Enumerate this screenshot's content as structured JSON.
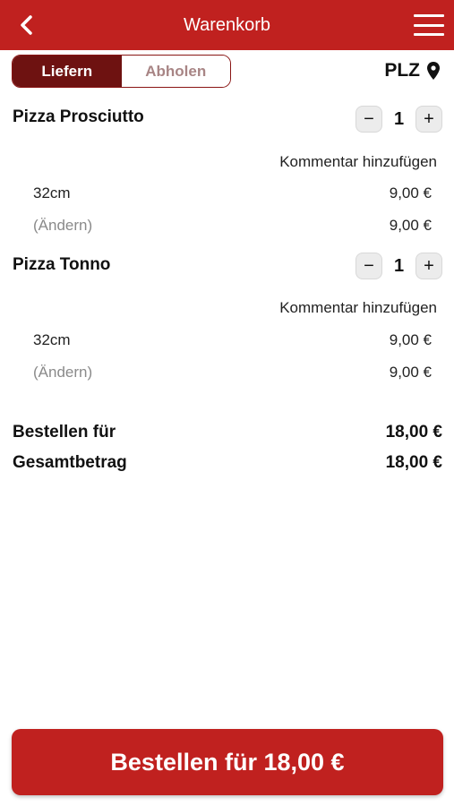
{
  "header": {
    "title": "Warenkorb"
  },
  "toggle": {
    "deliver": "Liefern",
    "pickup": "Abholen"
  },
  "plz": {
    "label": "PLZ"
  },
  "items": [
    {
      "name": "Pizza Prosciutto",
      "quantity": "1",
      "comment": "Kommentar hinzufügen",
      "size": "32cm",
      "size_price": "9,00 €",
      "change": "(Ändern)",
      "total": "9,00 €"
    },
    {
      "name": "Pizza Tonno",
      "quantity": "1",
      "comment": "Kommentar hinzufügen",
      "size": "32cm",
      "size_price": "9,00 €",
      "change": "(Ändern)",
      "total": "9,00 €"
    }
  ],
  "summary": {
    "order_for_label": "Bestellen für",
    "order_for_value": "18,00 €",
    "total_label": "Gesamtbetrag",
    "total_value": "18,00 €"
  },
  "order_button": {
    "label": "Bestellen für 18,00 €"
  },
  "colors": {
    "brand": "#c0211f",
    "toggle_active": "#6e1211"
  },
  "icons": {
    "back": "chevron-left-icon",
    "menu": "hamburger-menu-icon",
    "location": "map-pin-icon"
  }
}
